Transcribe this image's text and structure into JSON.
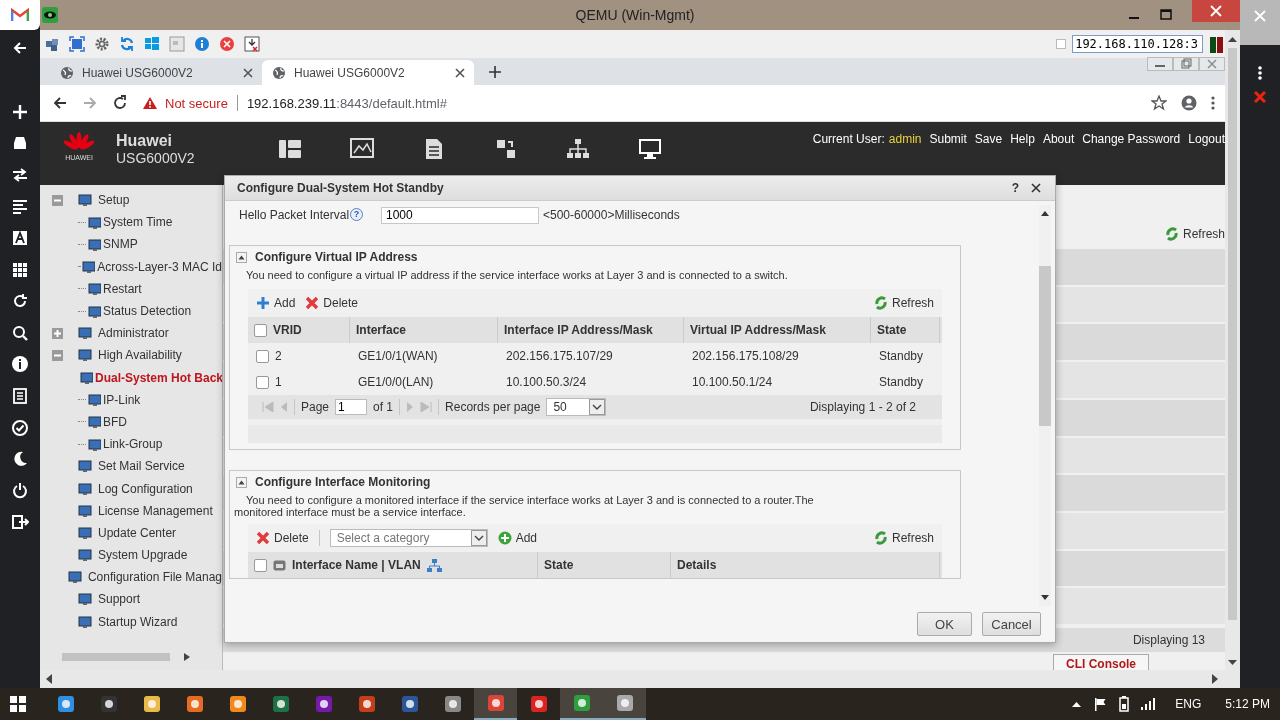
{
  "host_window": {
    "title": "QEMU (Win-Mgmt)",
    "option_checked": false,
    "address": "192.168.110.128:3"
  },
  "browser": {
    "tabs": [
      {
        "title": "Huawei USG6000V2",
        "selected": false
      },
      {
        "title": "Huawei USG6000V2",
        "selected": true
      }
    ],
    "security": "Not secure",
    "url_host": "192.168.239.11",
    "url_rest": ":8443/default.html#"
  },
  "header": {
    "logo_text": "HUAWEI",
    "brand": "Huawei",
    "model": "USG6000V2",
    "user_label": "Current User:",
    "user": "admin",
    "links": [
      "Submit",
      "Save",
      "Help",
      "About",
      "Change Password",
      "Logout"
    ]
  },
  "sidebar": {
    "items": [
      {
        "kind": "group",
        "label": "Setup",
        "expanded": true,
        "selected": false,
        "children": [
          {
            "label": "System Time",
            "selected": false
          },
          {
            "label": "SNMP",
            "selected": false
          },
          {
            "label": "Across-Layer-3 MAC Id",
            "selected": false
          },
          {
            "label": "Restart",
            "selected": false
          },
          {
            "label": "Status Detection",
            "selected": false
          }
        ]
      },
      {
        "kind": "group",
        "label": "Administrator",
        "expanded": false,
        "selected": false
      },
      {
        "kind": "group",
        "label": "High Availability",
        "expanded": true,
        "selected": false,
        "children": [
          {
            "label": "Dual-System Hot Back",
            "selected": true
          },
          {
            "label": "IP-Link",
            "selected": false
          },
          {
            "label": "BFD",
            "selected": false
          },
          {
            "label": "Link-Group",
            "selected": false
          }
        ]
      },
      {
        "kind": "leaf",
        "label": "Set Mail Service",
        "selected": false
      },
      {
        "kind": "leaf",
        "label": "Log Configuration",
        "selected": false
      },
      {
        "kind": "leaf",
        "label": "License Management",
        "selected": false
      },
      {
        "kind": "leaf",
        "label": "Update Center",
        "selected": false
      },
      {
        "kind": "leaf",
        "label": "System Upgrade",
        "selected": false
      },
      {
        "kind": "leaf",
        "label": "Configuration File Manag",
        "selected": false
      },
      {
        "kind": "leaf",
        "label": "Support",
        "selected": false
      },
      {
        "kind": "leaf",
        "label": "Startup Wizard",
        "selected": false
      }
    ]
  },
  "background_panel": {
    "refresh": "Refresh",
    "status": "Displaying 13",
    "cli_button": "CLI Console"
  },
  "dialog": {
    "title": "Configure Dual-System Hot Standby",
    "help": "?",
    "hello": {
      "label": "Hello Packet Interval",
      "help": "?",
      "value": "1000",
      "hint": "<500-60000>Milliseconds"
    },
    "vip": {
      "title": "Configure Virtual IP Address",
      "note": "You need to configure a virtual IP address if the service interface works at Layer 3 and is connected to a switch.",
      "add": "Add",
      "delete": "Delete",
      "refresh": "Refresh",
      "all_checked": false,
      "columns": [
        "VRID",
        "Interface",
        "Interface IP Address/Mask",
        "Virtual IP Address/Mask",
        "State"
      ],
      "rows": [
        {
          "checked": false,
          "cells": [
            "2",
            "GE1/0/1(WAN)",
            "202.156.175.107/29",
            "202.156.175.108/29",
            "Standby"
          ]
        },
        {
          "checked": false,
          "cells": [
            "1",
            "GE1/0/0(LAN)",
            "10.100.50.3/24",
            "10.100.50.1/24",
            "Standby"
          ]
        }
      ],
      "pager": {
        "page_label": "Page",
        "page": "1",
        "of": "of 1",
        "per_page_label": "Records per page",
        "per_page": "50",
        "status": "Displaying 1 - 2 of 2"
      }
    },
    "monitor": {
      "title": "Configure Interface Monitoring",
      "note": "You need to configure a monitored interface if the service interface works at Layer 3 and is connected to a router.The monitored interface must be a service interface.",
      "delete": "Delete",
      "category_placeholder": "Select a category",
      "add": "Add",
      "refresh": "Refresh",
      "all_checked": false,
      "columns": [
        "Interface Name | VLAN",
        "State",
        "Details"
      ]
    },
    "buttons": [
      "OK",
      "Cancel"
    ]
  },
  "taskbar": {
    "language": "ENG",
    "time": "5:12 PM"
  }
}
